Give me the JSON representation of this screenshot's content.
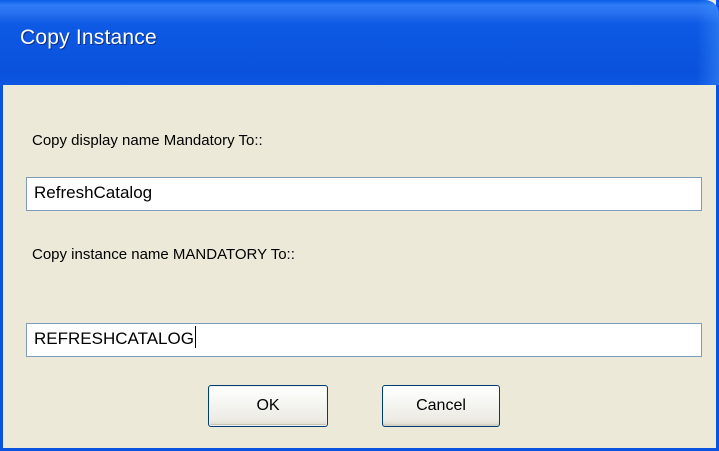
{
  "dialog": {
    "title": "Copy Instance",
    "display_name_label": "Copy display name Mandatory To::",
    "display_name_value": "RefreshCatalog",
    "instance_name_label": "Copy instance name MANDATORY To::",
    "instance_name_value": "REFRESHCATALOG",
    "ok_label": "OK",
    "cancel_label": "Cancel"
  },
  "colors": {
    "titlebar": "#0a55df",
    "window_border": "#0a53e0",
    "client_background": "#ece9d8",
    "button_border": "#003c74",
    "textbox_border": "#7f9db9"
  }
}
